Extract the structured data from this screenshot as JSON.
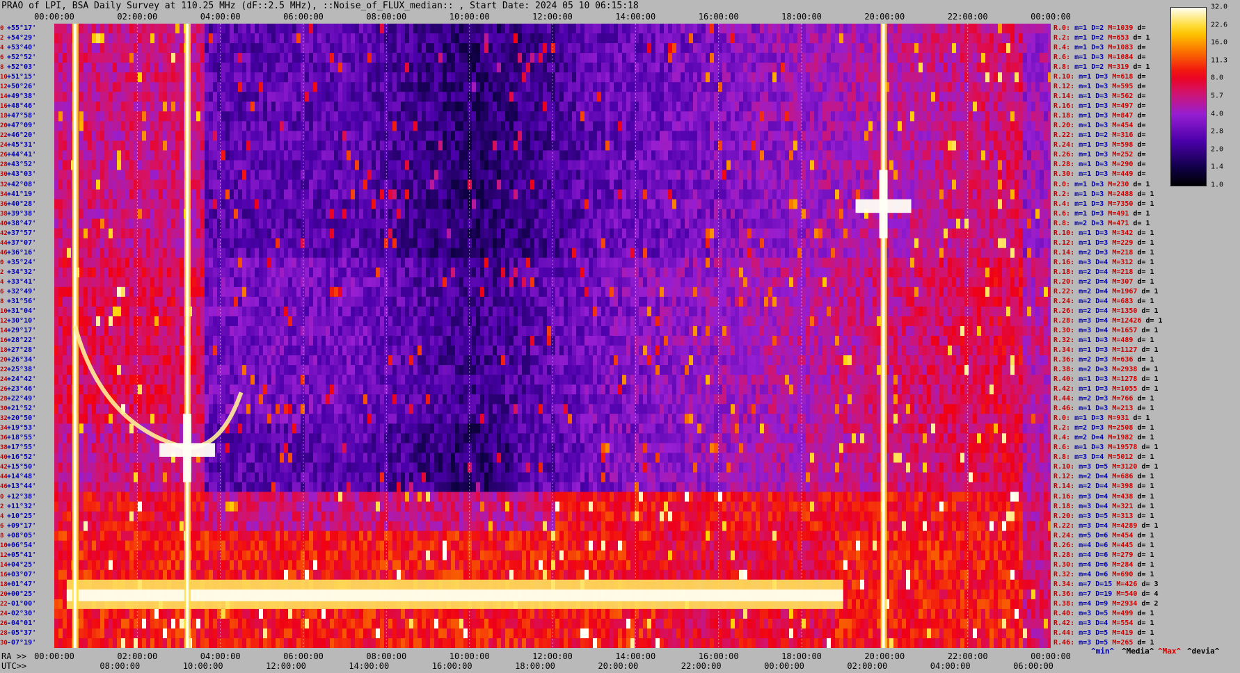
{
  "title": "PRAO of LPI, BSA Daily Survey at 110.25 MHz (dF::2.5 MHz), ::Noise_of_FLUX_median:: , Start Date: 2024 05 10 06:15:18",
  "axes": {
    "top_ticks": [
      "00:00:00",
      "02:00:00",
      "04:00:00",
      "06:00:00",
      "08:00:00",
      "10:00:00",
      "12:00:00",
      "14:00:00",
      "16:00:00",
      "18:00:00",
      "20:00:00",
      "22:00:00",
      "00:00:00"
    ],
    "ra_label": "RA >>",
    "ra_ticks": [
      "00:00:00",
      "02:00:00",
      "04:00:00",
      "06:00:00",
      "08:00:00",
      "10:00:00",
      "12:00:00",
      "14:00:00",
      "16:00:00",
      "18:00:00",
      "20:00:00",
      "22:00:00",
      "00:00:00"
    ],
    "utc_label": "UTC>>",
    "utc_ticks": [
      "08:00:00",
      "10:00:00",
      "12:00:00",
      "14:00:00",
      "16:00:00",
      "18:00:00",
      "20:00:00",
      "22:00:00",
      "00:00:00",
      "02:00:00",
      "04:00:00",
      "06:00:00"
    ]
  },
  "declinations": [
    "+55°17'",
    "+54°29'",
    "+53°40'",
    "+52°52'",
    "+52°03'",
    "+51°15'",
    "+50°26'",
    "+49°38'",
    "+48°46'",
    "+47°58'",
    "+47°09'",
    "+46°20'",
    "+45°31'",
    "+44°41'",
    "+43°52'",
    "+43°03'",
    "+42°08'",
    "+41°19'",
    "+40°28'",
    "+39°38'",
    "+38°47'",
    "+37°57'",
    "+37°07'",
    "+36°16'",
    "+35°24'",
    "+34°32'",
    "+33°41'",
    "+32°49'",
    "+31°56'",
    "+31°04'",
    "+30°10'",
    "+29°17'",
    "+28°22'",
    "+27°28'",
    "+26°34'",
    "+25°38'",
    "+24°42'",
    "+23°46'",
    "+22°49'",
    "+21°52'",
    "+20°50'",
    "+19°53'",
    "+18°55'",
    "+17°55'",
    "+16°52'",
    "+15°50'",
    "+14°48'",
    "+13°44'",
    "+12°38'",
    "+11°32'",
    "+10°25'",
    "+09°17'",
    "+08°05'",
    "+06°54'",
    "+05°41'",
    "+04°25'",
    "+03°07'",
    "+01°47'",
    "+00°25'",
    "-01°00'",
    "-02°30'",
    "-04°01'",
    "-05°37'",
    "-07°19'"
  ],
  "row_indices": [
    "0",
    "2",
    "4",
    "6",
    "8",
    "10",
    "12",
    "14",
    "16",
    "18",
    "20",
    "22",
    "24",
    "26",
    "28",
    "30",
    "32",
    "34",
    "36",
    "38",
    "40",
    "42",
    "44",
    "46",
    "0",
    "2",
    "4",
    "6",
    "8",
    "10",
    "12",
    "14",
    "16",
    "18",
    "20",
    "22",
    "24",
    "26",
    "28",
    "30",
    "32",
    "34",
    "36",
    "38",
    "40",
    "42",
    "44",
    "46",
    "0",
    "2",
    "4",
    "6",
    "8",
    "10",
    "12",
    "14",
    "16",
    "18",
    "20",
    "22",
    "24",
    "26",
    "28",
    "30"
  ],
  "stats": [
    {
      "r": "R.0:",
      "m": "m=1",
      "d": "D=2",
      "M": "M=1039",
      "dv": "d="
    },
    {
      "r": "R.2:",
      "m": "m=1",
      "d": "D=2",
      "M": "M=653",
      "dv": "d= 1"
    },
    {
      "r": "R.4:",
      "m": "m=1",
      "d": "D=3",
      "M": "M=1083",
      "dv": "d="
    },
    {
      "r": "R.6:",
      "m": "m=1",
      "d": "D=3",
      "M": "M=1084",
      "dv": "d="
    },
    {
      "r": "R.8:",
      "m": "m=1",
      "d": "D=2",
      "M": "M=319",
      "dv": "d= 1"
    },
    {
      "r": "R.10:",
      "m": "m=1",
      "d": "D=3",
      "M": "M=618",
      "dv": "d="
    },
    {
      "r": "R.12:",
      "m": "m=1",
      "d": "D=3",
      "M": "M=595",
      "dv": "d="
    },
    {
      "r": "R.14:",
      "m": "m=1",
      "d": "D=3",
      "M": "M=562",
      "dv": "d="
    },
    {
      "r": "R.16:",
      "m": "m=1",
      "d": "D=3",
      "M": "M=497",
      "dv": "d="
    },
    {
      "r": "R.18:",
      "m": "m=1",
      "d": "D=3",
      "M": "M=847",
      "dv": "d="
    },
    {
      "r": "R.20:",
      "m": "m=1",
      "d": "D=3",
      "M": "M=454",
      "dv": "d="
    },
    {
      "r": "R.22:",
      "m": "m=1",
      "d": "D=2",
      "M": "M=316",
      "dv": "d="
    },
    {
      "r": "R.24:",
      "m": "m=1",
      "d": "D=3",
      "M": "M=598",
      "dv": "d="
    },
    {
      "r": "R.26:",
      "m": "m=1",
      "d": "D=3",
      "M": "M=252",
      "dv": "d="
    },
    {
      "r": "R.28:",
      "m": "m=1",
      "d": "D=3",
      "M": "M=290",
      "dv": "d="
    },
    {
      "r": "R.30:",
      "m": "m=1",
      "d": "D=3",
      "M": "M=449",
      "dv": "d="
    },
    {
      "r": "R.0:",
      "m": "m=1",
      "d": "D=3",
      "M": "M=230",
      "dv": "d= 1"
    },
    {
      "r": "R.2:",
      "m": "m=1",
      "d": "D=3",
      "M": "M=2488",
      "dv": "d= 1"
    },
    {
      "r": "R.4:",
      "m": "m=1",
      "d": "D=3",
      "M": "M=7350",
      "dv": "d= 1"
    },
    {
      "r": "R.6:",
      "m": "m=1",
      "d": "D=3",
      "M": "M=491",
      "dv": "d= 1"
    },
    {
      "r": "R.8:",
      "m": "m=2",
      "d": "D=3",
      "M": "M=471",
      "dv": "d= 1"
    },
    {
      "r": "R.10:",
      "m": "m=1",
      "d": "D=3",
      "M": "M=342",
      "dv": "d= 1"
    },
    {
      "r": "R.12:",
      "m": "m=1",
      "d": "D=3",
      "M": "M=229",
      "dv": "d= 1"
    },
    {
      "r": "R.14:",
      "m": "m=2",
      "d": "D=3",
      "M": "M=218",
      "dv": "d= 1"
    },
    {
      "r": "R.16:",
      "m": "m=3",
      "d": "D=4",
      "M": "M=312",
      "dv": "d= 1"
    },
    {
      "r": "R.18:",
      "m": "m=2",
      "d": "D=4",
      "M": "M=218",
      "dv": "d= 1"
    },
    {
      "r": "R.20:",
      "m": "m=2",
      "d": "D=4",
      "M": "M=307",
      "dv": "d= 1"
    },
    {
      "r": "R.22:",
      "m": "m=2",
      "d": "D=4",
      "M": "M=1967",
      "dv": "d= 1"
    },
    {
      "r": "R.24:",
      "m": "m=2",
      "d": "D=4",
      "M": "M=683",
      "dv": "d= 1"
    },
    {
      "r": "R.26:",
      "m": "m=2",
      "d": "D=4",
      "M": "M=1350",
      "dv": "d= 1"
    },
    {
      "r": "R.28:",
      "m": "m=3",
      "d": "D=4",
      "M": "M=12426",
      "dv": "d= 1"
    },
    {
      "r": "R.30:",
      "m": "m=3",
      "d": "D=4",
      "M": "M=1657",
      "dv": "d= 1"
    },
    {
      "r": "R.32:",
      "m": "m=1",
      "d": "D=3",
      "M": "M=489",
      "dv": "d= 1"
    },
    {
      "r": "R.34:",
      "m": "m=1",
      "d": "D=3",
      "M": "M=1127",
      "dv": "d= 1"
    },
    {
      "r": "R.36:",
      "m": "m=2",
      "d": "D=3",
      "M": "M=636",
      "dv": "d= 1"
    },
    {
      "r": "R.38:",
      "m": "m=2",
      "d": "D=3",
      "M": "M=2938",
      "dv": "d= 1"
    },
    {
      "r": "R.40:",
      "m": "m=1",
      "d": "D=3",
      "M": "M=1278",
      "dv": "d= 1"
    },
    {
      "r": "R.42:",
      "m": "m=1",
      "d": "D=3",
      "M": "M=1055",
      "dv": "d= 1"
    },
    {
      "r": "R.44:",
      "m": "m=2",
      "d": "D=3",
      "M": "M=766",
      "dv": "d= 1"
    },
    {
      "r": "R.46:",
      "m": "m=1",
      "d": "D=3",
      "M": "M=213",
      "dv": "d= 1"
    },
    {
      "r": "R.0:",
      "m": "m=1",
      "d": "D=3",
      "M": "M=931",
      "dv": "d= 1"
    },
    {
      "r": "R.2:",
      "m": "m=2",
      "d": "D=3",
      "M": "M=2508",
      "dv": "d= 1"
    },
    {
      "r": "R.4:",
      "m": "m=2",
      "d": "D=4",
      "M": "M=1982",
      "dv": "d= 1"
    },
    {
      "r": "R.6:",
      "m": "m=1",
      "d": "D=3",
      "M": "M=19578",
      "dv": "d= 1"
    },
    {
      "r": "R.8:",
      "m": "m=3",
      "d": "D=4",
      "M": "M=5012",
      "dv": "d= 1"
    },
    {
      "r": "R.10:",
      "m": "m=3",
      "d": "D=5",
      "M": "M=3120",
      "dv": "d= 1"
    },
    {
      "r": "R.12:",
      "m": "m=2",
      "d": "D=4",
      "M": "M=686",
      "dv": "d= 1"
    },
    {
      "r": "R.14:",
      "m": "m=2",
      "d": "D=4",
      "M": "M=398",
      "dv": "d= 1"
    },
    {
      "r": "R.16:",
      "m": "m=3",
      "d": "D=4",
      "M": "M=438",
      "dv": "d= 1"
    },
    {
      "r": "R.18:",
      "m": "m=3",
      "d": "D=4",
      "M": "M=321",
      "dv": "d= 1"
    },
    {
      "r": "R.20:",
      "m": "m=3",
      "d": "D=5",
      "M": "M=313",
      "dv": "d= 1"
    },
    {
      "r": "R.22:",
      "m": "m=3",
      "d": "D=4",
      "M": "M=4289",
      "dv": "d= 1"
    },
    {
      "r": "R.24:",
      "m": "m=5",
      "d": "D=6",
      "M": "M=454",
      "dv": "d= 1"
    },
    {
      "r": "R.26:",
      "m": "m=4",
      "d": "D=6",
      "M": "M=445",
      "dv": "d= 1"
    },
    {
      "r": "R.28:",
      "m": "m=4",
      "d": "D=6",
      "M": "M=279",
      "dv": "d= 1"
    },
    {
      "r": "R.30:",
      "m": "m=4",
      "d": "D=6",
      "M": "M=284",
      "dv": "d= 1"
    },
    {
      "r": "R.32:",
      "m": "m=4",
      "d": "D=6",
      "M": "M=690",
      "dv": "d= 1"
    },
    {
      "r": "R.34:",
      "m": "m=7",
      "d": "D=15",
      "M": "M=426",
      "dv": "d= 3"
    },
    {
      "r": "R.36:",
      "m": "m=7",
      "d": "D=19",
      "M": "M=540",
      "dv": "d= 4"
    },
    {
      "r": "R.38:",
      "m": "m=4",
      "d": "D=9",
      "M": "M=2934",
      "dv": "d= 2"
    },
    {
      "r": "R.40:",
      "m": "m=3",
      "d": "D=5",
      "M": "M=499",
      "dv": "d= 1"
    },
    {
      "r": "R.42:",
      "m": "m=3",
      "d": "D=4",
      "M": "M=554",
      "dv": "d= 1"
    },
    {
      "r": "R.44:",
      "m": "m=3",
      "d": "D=5",
      "M": "M=419",
      "dv": "d= 1"
    },
    {
      "r": "R.46:",
      "m": "m=3",
      "d": "D=5",
      "M": "M=265",
      "dv": "d= 1"
    }
  ],
  "colorbar": {
    "labels": [
      "32.0",
      "22.6",
      "16.0",
      "11.3",
      "8.0",
      "5.7",
      "4.0",
      "2.8",
      "2.0",
      "1.4",
      "1.0"
    ]
  },
  "footer": {
    "min": "^min^",
    "media": "^Media^",
    "max": "^Max^",
    "devia": "^devia^"
  },
  "chart_data": {
    "type": "heatmap",
    "title": "PRAO of LPI, BSA Daily Survey at 110.25 MHz (dF::2.5 MHz), ::Noise_of_FLUX_median:: , Start Date: 2024 05 10 06:15:18",
    "x_axis": "RA 00:00:00 – 24:00:00 (UTC 06:15 – 06:15)",
    "y_axis": "Declination +55°17' to -07°19'",
    "color_scale": {
      "min": 1.0,
      "max": 32.0,
      "scale": "log2"
    },
    "features": [
      {
        "type": "vertical_bright_track",
        "ra_hours": 0.5
      },
      {
        "type": "vertical_bright_track",
        "ra_hours": 3.2
      },
      {
        "type": "vertical_bright_track",
        "ra_hours": 19.97
      },
      {
        "type": "horizontal_bright_band",
        "dec_range": [
          "+01°47'",
          "-01°00'"
        ],
        "ra_range_hours": [
          0.3,
          19.0
        ]
      },
      {
        "type": "arc_track",
        "from_ra_hours": 0.5,
        "to_ra_hours": 4.5,
        "dec_range": [
          "+29°17'",
          "+17°55'"
        ]
      },
      {
        "type": "bright_cross",
        "ra_hours": 3.2,
        "dec": "+17°55'"
      },
      {
        "type": "bright_cross",
        "ra_hours": 19.97,
        "dec": "+40°28'"
      }
    ]
  }
}
